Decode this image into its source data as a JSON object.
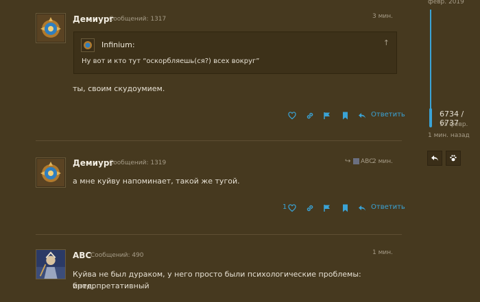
{
  "accent_color": "#3aa3d6",
  "timeline": {
    "top_date": "февр. 2019",
    "position": "6734 / 6737",
    "date": "11 февр.",
    "ago": "1 мин. назад",
    "buttons": [
      {
        "icon": "reply-icon"
      },
      {
        "icon": "paw-icon"
      }
    ]
  },
  "posts": [
    {
      "username": "Демиург",
      "post_count": "Сообщений: 1317",
      "time": "3 мин.",
      "avatar_icon": "hearthstone-emblem",
      "quote": {
        "author": "Infinium:",
        "text": "Ну вот и кто тут “оскорбляешь(ся?) всех вокруг”"
      },
      "text": "ты, своим скудоумием.",
      "reply_label": "Ответить",
      "like_count": ""
    },
    {
      "username": "Демиург",
      "post_count": "Сообщений: 1319",
      "time": "2 мин.",
      "via_user": "ABC",
      "avatar_icon": "hearthstone-emblem",
      "text": "а мне куйву напоминает, такой же тугой.",
      "reply_label": "Ответить",
      "like_count": "1"
    },
    {
      "username": "ABC",
      "post_count": "Сообщений: 490",
      "time": "1 мин.",
      "avatar_icon": "character-portrait",
      "text_line1": "Куйва не был дураком, у него просто были психологические проблемы: интерпретативный",
      "text_line2": "бред."
    }
  ]
}
